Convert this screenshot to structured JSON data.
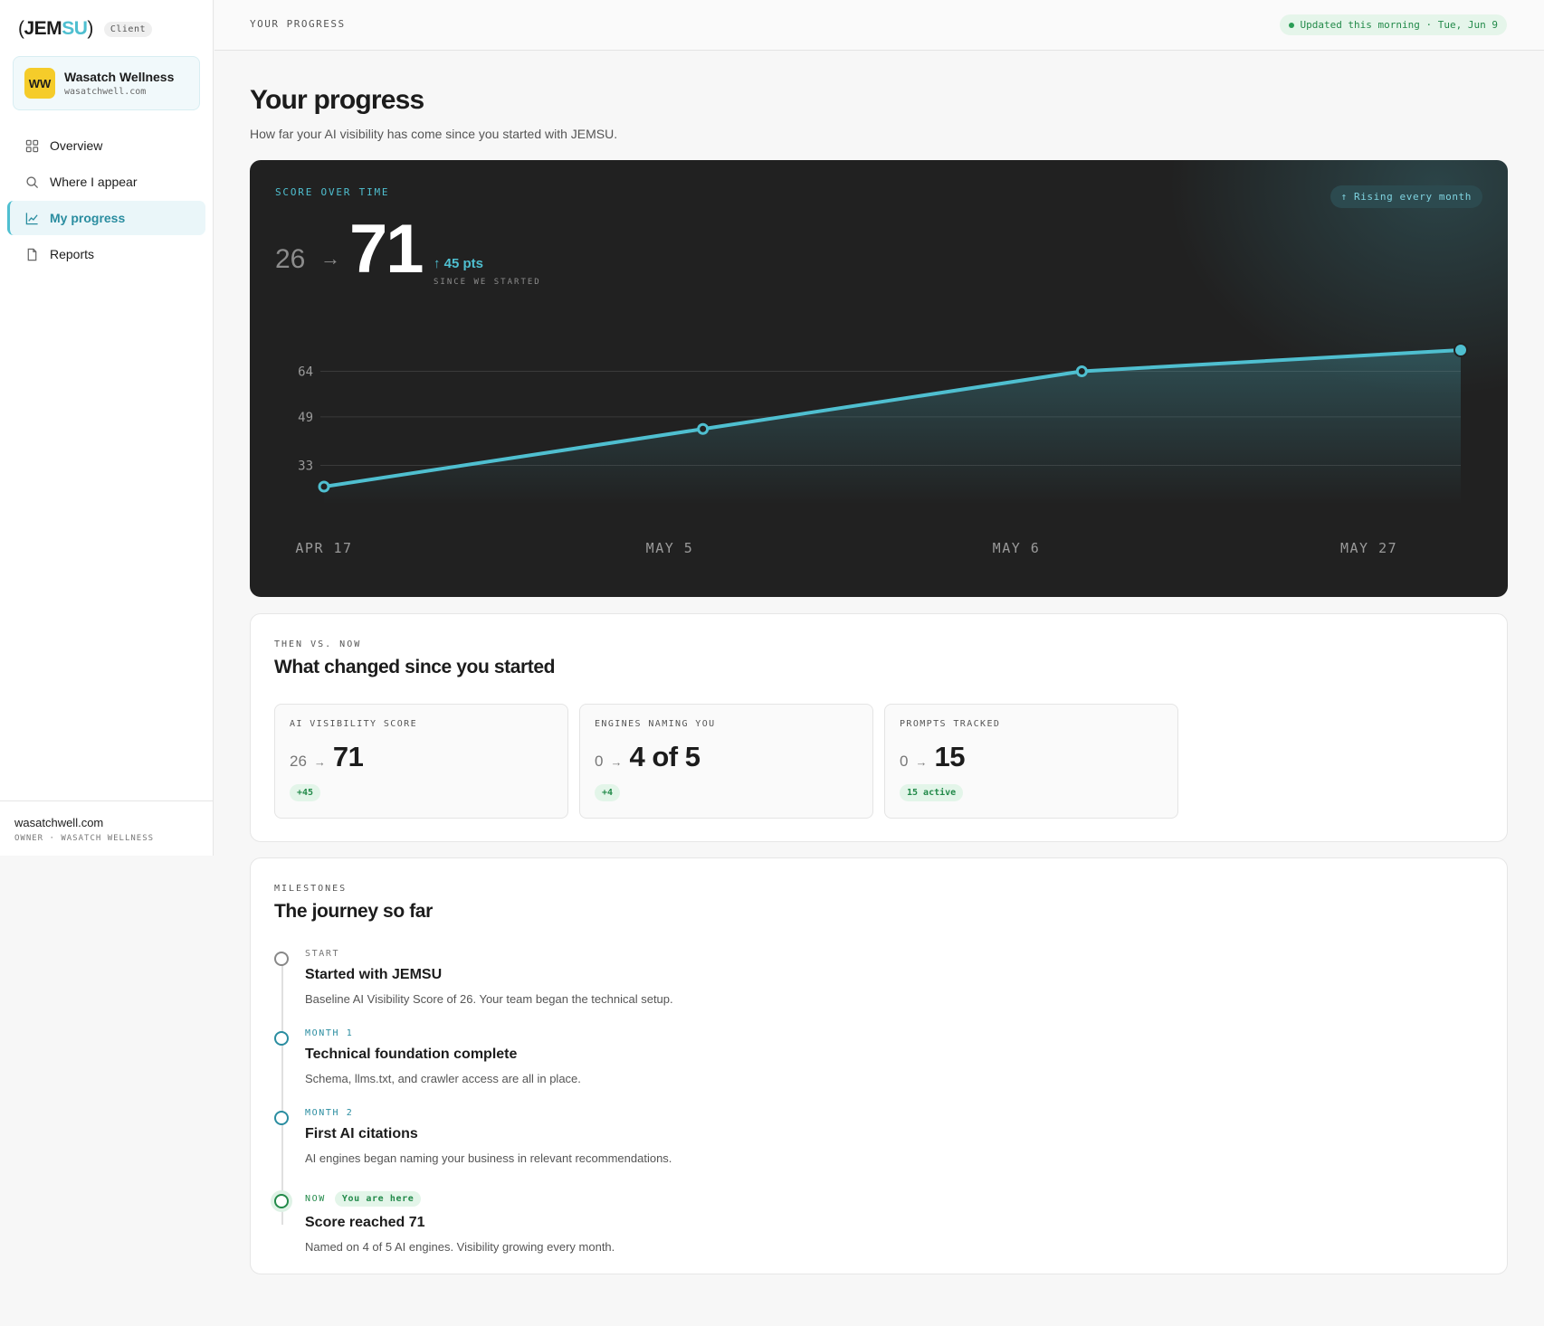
{
  "brand": {
    "logo_open": "(",
    "logo_jem": "JEM",
    "logo_su": "SU",
    "logo_close": ")",
    "badge": "Client"
  },
  "org": {
    "initials": "WW",
    "name": "Wasatch Wellness",
    "domain": "wasatchwell.com"
  },
  "nav": [
    {
      "label": "Overview",
      "icon": "grid-icon",
      "active": false
    },
    {
      "label": "Where I appear",
      "icon": "search-icon",
      "active": false
    },
    {
      "label": "My progress",
      "icon": "line-chart-icon",
      "active": true
    },
    {
      "label": "Reports",
      "icon": "document-icon",
      "active": false
    }
  ],
  "sidebar_footer": {
    "domain": "wasatchwell.com",
    "role": "OWNER · WASATCH WELLNESS"
  },
  "topbar": {
    "breadcrumb": "YOUR PROGRESS",
    "updated": "Updated this morning · Tue, Jun 9"
  },
  "page": {
    "title": "Your progress",
    "subtitle": "How far your AI visibility has come since you started with JEMSU."
  },
  "score": {
    "label": "SCORE OVER TIME",
    "from": "26",
    "to": "71",
    "delta": "↑ 45 pts",
    "since": "SINCE WE STARTED",
    "badge": "↑ Rising every month"
  },
  "chart_data": {
    "type": "area",
    "categories": [
      "APR 17",
      "MAY 5",
      "MAY 6",
      "MAY 27"
    ],
    "values": [
      26,
      45,
      64,
      71
    ],
    "y_ticks": [
      33,
      49,
      64
    ],
    "ylim": [
      26,
      71
    ],
    "grid": true,
    "colors": {
      "line": "#4fbfd0",
      "fill": "#4fbfd0",
      "grid": "#3a3a3a",
      "tick": "#9a9a9a"
    }
  },
  "then_now": {
    "eyebrow": "THEN VS. NOW",
    "title": "What changed since you started",
    "stats": [
      {
        "label": "AI VISIBILITY SCORE",
        "from": "26",
        "to": "71",
        "chip": "+45"
      },
      {
        "label": "ENGINES NAMING YOU",
        "from": "0",
        "to": "4 of 5",
        "chip": "+4"
      },
      {
        "label": "PROMPTS TRACKED",
        "from": "0",
        "to": "15",
        "chip": "15 active"
      }
    ]
  },
  "milestones": {
    "eyebrow": "MILESTONES",
    "title": "The journey so far",
    "items": [
      {
        "tag": "START",
        "title": "Started with JEMSU",
        "desc": "Baseline AI Visibility Score of 26. Your team began the technical setup."
      },
      {
        "tag": "MONTH 1",
        "title": "Technical foundation complete",
        "desc": "Schema, llms.txt, and crawler access are all in place."
      },
      {
        "tag": "MONTH 2",
        "title": "First AI citations",
        "desc": "AI engines began naming your business in relevant recommendations."
      },
      {
        "tag": "NOW",
        "here": "You are here",
        "title": "Score reached 71",
        "desc": "Named on 4 of 5 AI engines. Visibility growing every month."
      }
    ]
  }
}
